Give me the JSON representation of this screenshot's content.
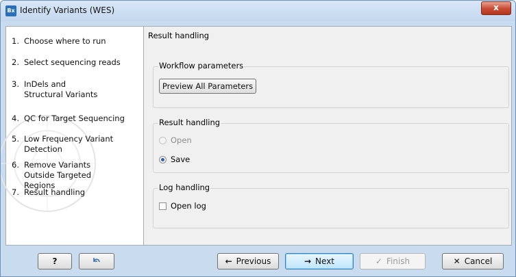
{
  "window": {
    "title": "Identify Variants (WES)",
    "icon_text": "Bx",
    "close_label": "x"
  },
  "steps": [
    {
      "num": "1.",
      "label": "Choose where to run"
    },
    {
      "num": "2.",
      "label": "Select sequencing reads"
    },
    {
      "num": "3.",
      "label": "InDels and Structural Variants"
    },
    {
      "num": "4.",
      "label": "QC for Target Sequencing"
    },
    {
      "num": "5.",
      "label": "Low Frequency Variant Detection"
    },
    {
      "num": "6.",
      "label": "Remove Variants Outside Targeted Regions"
    },
    {
      "num": "7.",
      "label": "Result handling"
    }
  ],
  "main": {
    "section_title": "Result handling",
    "workflow_group": {
      "label": "Workflow parameters",
      "preview_button": "Preview All Parameters"
    },
    "result_group": {
      "label": "Result handling",
      "open_option": "Open",
      "save_option": "Save",
      "selected": "Save"
    },
    "log_group": {
      "label": "Log handling",
      "open_log": "Open log",
      "open_log_checked": false
    }
  },
  "footer": {
    "help": "?",
    "reset_icon": "reset-arrow-icon",
    "previous": "Previous",
    "next": "Next",
    "finish": "Finish",
    "cancel": "Cancel"
  },
  "colors": {
    "title_bar": "#c9dbef",
    "close_button": "#c74a32",
    "radio_selected": "#2f62a6"
  }
}
